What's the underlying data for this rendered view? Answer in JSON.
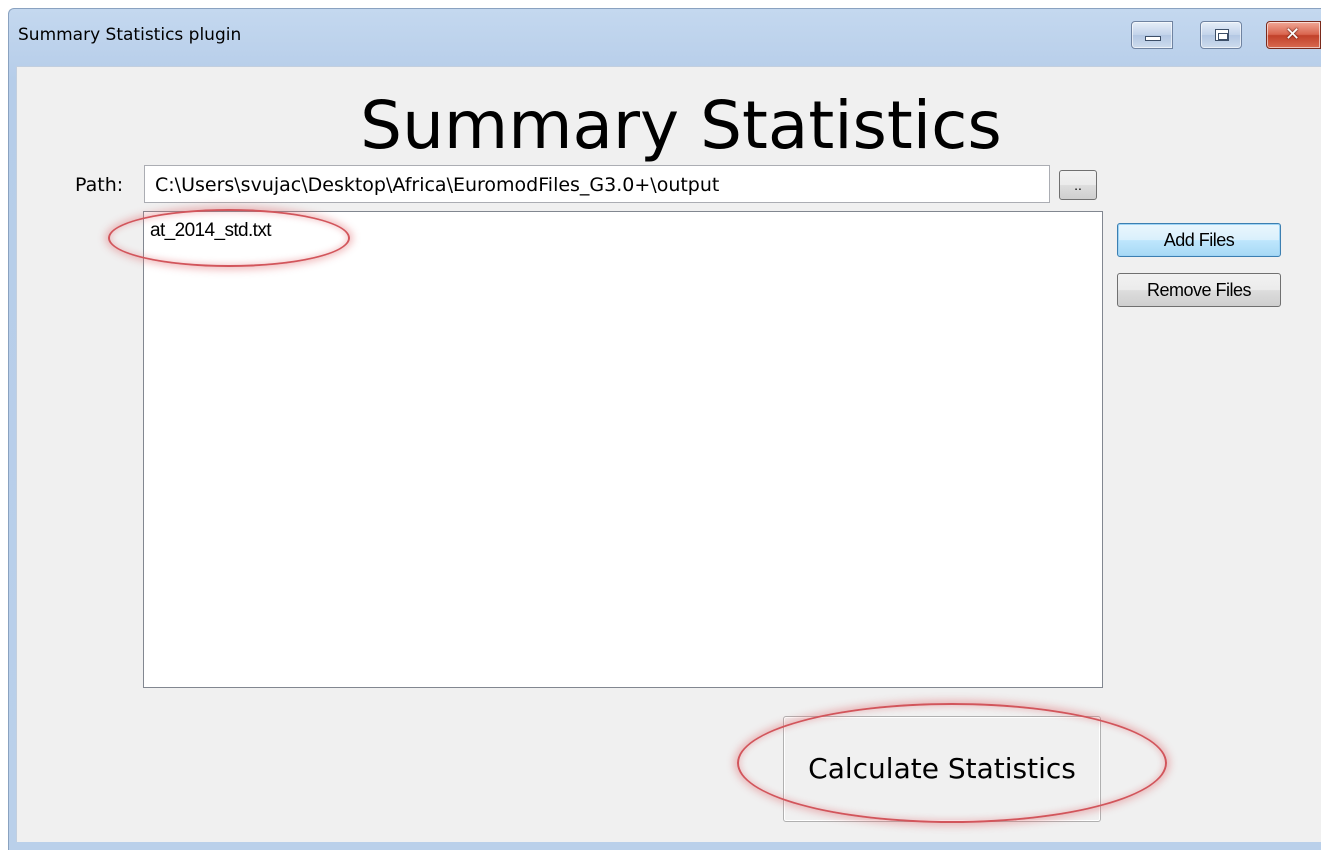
{
  "window": {
    "title": "Summary Statistics plugin",
    "controls": {
      "minimize": "minimize-icon",
      "maximize": "maximize-icon",
      "close": "close-icon"
    }
  },
  "main": {
    "heading": "Summary Statistics",
    "path": {
      "label": "Path:",
      "value": "C:\\Users\\svujac\\Desktop\\Africa\\EuromodFiles_G3.0+\\output",
      "browse_label": ".."
    },
    "files": [
      "at_2014_std.txt"
    ],
    "buttons": {
      "add_files": "Add Files",
      "remove_files": "Remove Files",
      "calculate": "Calculate Statistics"
    }
  },
  "annotations": {
    "highlight_color": "#d2555b"
  }
}
